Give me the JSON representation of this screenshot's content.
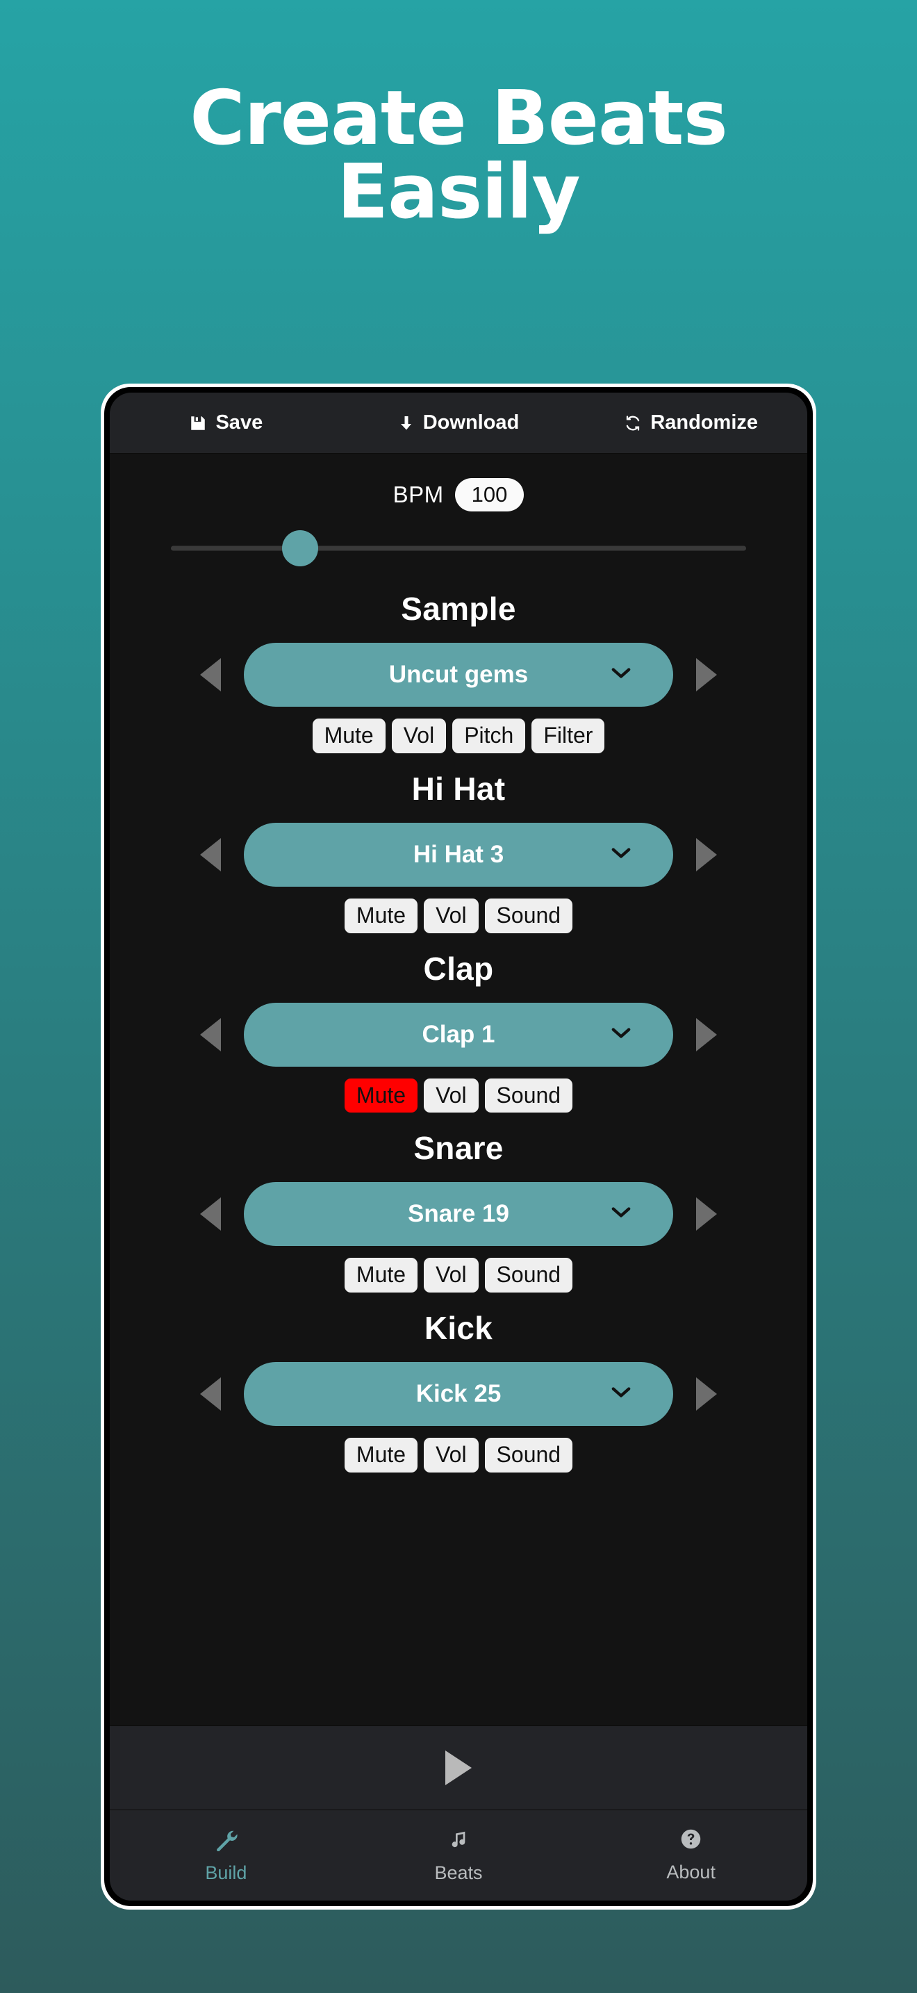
{
  "headline": {
    "line1": "Create Beats",
    "line2": "Easily"
  },
  "colors": {
    "bg_top": "#26A3A5",
    "bg_mid": "#2A8183",
    "bg_bottom": "#2D5B5C",
    "accent_teal": "#5FA3A7",
    "mute_active_red": "#FF0000",
    "screen_bg": "#131313",
    "bar_bg": "#232428",
    "chip_bg": "#EFEFEF"
  },
  "toolbar": {
    "items": [
      {
        "label": "Save",
        "icon": "floppy-disk-icon"
      },
      {
        "label": "Download",
        "icon": "download-arrow-icon"
      },
      {
        "label": "Randomize",
        "icon": "shuffle-refresh-icon"
      }
    ]
  },
  "bpm": {
    "label": "BPM",
    "value": "100",
    "slider_position_percent": 22.5
  },
  "sections": [
    {
      "title": "Sample",
      "selected": "Uncut gems",
      "prev_icon": "triangle-left-icon",
      "next_icon": "triangle-right-icon",
      "dropdown_icon": "chevron-down-icon",
      "chips": [
        {
          "label": "Mute",
          "active": false
        },
        {
          "label": "Vol",
          "active": false
        },
        {
          "label": "Pitch",
          "active": false
        },
        {
          "label": "Filter",
          "active": false
        }
      ]
    },
    {
      "title": "Hi Hat",
      "selected": "Hi Hat 3",
      "prev_icon": "triangle-left-icon",
      "next_icon": "triangle-right-icon",
      "dropdown_icon": "chevron-down-icon",
      "chips": [
        {
          "label": "Mute",
          "active": false
        },
        {
          "label": "Vol",
          "active": false
        },
        {
          "label": "Sound",
          "active": false
        }
      ]
    },
    {
      "title": "Clap",
      "selected": "Clap 1",
      "prev_icon": "triangle-left-icon",
      "next_icon": "triangle-right-icon",
      "dropdown_icon": "chevron-down-icon",
      "chips": [
        {
          "label": "Mute",
          "active": true
        },
        {
          "label": "Vol",
          "active": false
        },
        {
          "label": "Sound",
          "active": false
        }
      ]
    },
    {
      "title": "Snare",
      "selected": "Snare 19",
      "prev_icon": "triangle-left-icon",
      "next_icon": "triangle-right-icon",
      "dropdown_icon": "chevron-down-icon",
      "chips": [
        {
          "label": "Mute",
          "active": false
        },
        {
          "label": "Vol",
          "active": false
        },
        {
          "label": "Sound",
          "active": false
        }
      ]
    },
    {
      "title": "Kick",
      "selected": "Kick 25",
      "prev_icon": "triangle-left-icon",
      "next_icon": "triangle-right-icon",
      "dropdown_icon": "chevron-down-icon",
      "chips": [
        {
          "label": "Mute",
          "active": false
        },
        {
          "label": "Vol",
          "active": false
        },
        {
          "label": "Sound",
          "active": false
        }
      ]
    }
  ],
  "transport": {
    "play_icon": "play-triangle-icon"
  },
  "bottom_nav": {
    "items": [
      {
        "label": "Build",
        "icon": "wrench-icon",
        "active": true
      },
      {
        "label": "Beats",
        "icon": "music-note-icon",
        "active": false
      },
      {
        "label": "About",
        "icon": "question-circle-icon",
        "active": false
      }
    ]
  }
}
